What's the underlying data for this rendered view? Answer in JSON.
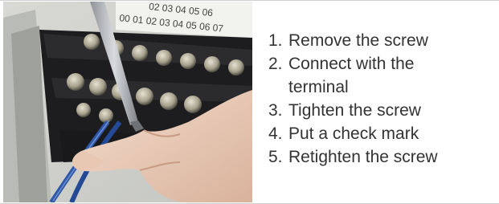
{
  "photo": {
    "icon": "terminal-block-wiring-photo",
    "terminal_numbers_top": [
      "02",
      "03",
      "04",
      "05",
      "06"
    ],
    "terminal_numbers_bottom": [
      "00",
      "01",
      "02",
      "03",
      "04",
      "05",
      "06",
      "07"
    ]
  },
  "steps": [
    {
      "num": "1.",
      "text": "Remove the screw"
    },
    {
      "num": "2.",
      "text": "Connect with the",
      "cont": "terminal"
    },
    {
      "num": "3.",
      "text": "Tighten the screw"
    },
    {
      "num": "4.",
      "text": "Put a check mark"
    },
    {
      "num": "5.",
      "text": "Retighten the screw"
    }
  ]
}
